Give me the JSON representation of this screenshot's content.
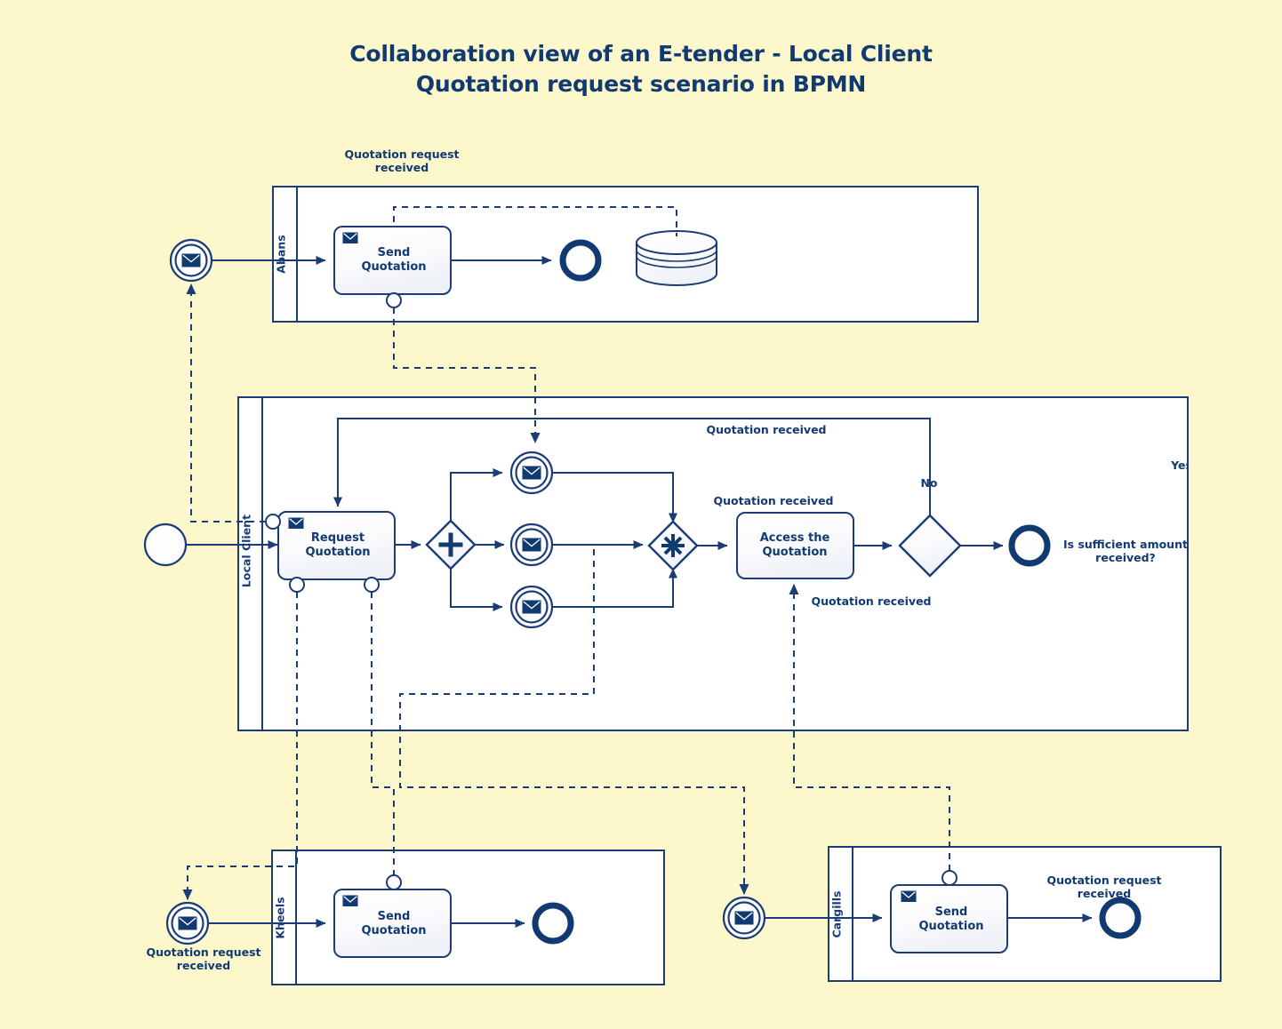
{
  "title": {
    "line1": "Collaboration view of an E-tender - Local Client",
    "line2": "Quotation request scenario in BPMN"
  },
  "colors": {
    "background": "#FCF8CC",
    "stroke": "#1C3C78",
    "text": "#113A72",
    "pool_fill": "#FFFFFF"
  },
  "pools": [
    {
      "id": "abans",
      "lane_label": "Abans",
      "tasks": [
        {
          "label_line1": "Send",
          "label_line2": "Quotation"
        }
      ],
      "events": [
        {
          "name": "message-start-event",
          "label": "Quotation request\nreceived",
          "label_line1": "Quotation request",
          "label_line2": "received"
        },
        {
          "name": "end-event",
          "label": ""
        }
      ],
      "artifacts": [
        {
          "name": "data-store",
          "label": ""
        }
      ]
    },
    {
      "id": "local-client",
      "lane_label": "Local Client",
      "tasks": [
        {
          "label_line1": "Request",
          "label_line2": "Quotation"
        },
        {
          "label_line1": "Access the",
          "label_line2": "Quotation"
        }
      ],
      "gateways": [
        {
          "name": "parallel-gateway",
          "symbol": "+"
        },
        {
          "name": "complex-gateway",
          "symbol": "*"
        },
        {
          "name": "exclusive-gateway",
          "symbol": ""
        }
      ],
      "flow_labels": {
        "top_quotation_received": "Quotation received",
        "mid_quotation_received": "Quotation received",
        "bottom_quotation_received": "Quotation received",
        "no": "No",
        "yes": "Yes",
        "decision_question_line1": "Is sufficient amount",
        "decision_question_line2": "received?"
      }
    },
    {
      "id": "kheels",
      "lane_label": "Kheels",
      "tasks": [
        {
          "label_line1": "Send",
          "label_line2": "Quotation"
        }
      ],
      "events": [
        {
          "name": "message-start-event",
          "label_line1": "Quotation request",
          "label_line2": "received"
        },
        {
          "name": "end-event",
          "label": ""
        }
      ]
    },
    {
      "id": "cargills",
      "lane_label": "Cargills",
      "tasks": [
        {
          "label_line1": "Send",
          "label_line2": "Quotation"
        }
      ],
      "events": [
        {
          "name": "message-start-event",
          "label": ""
        },
        {
          "name": "end-event",
          "label_line1": "Quotation request",
          "label_line2": "received"
        }
      ]
    }
  ],
  "labels": {
    "abans_lane": "Abans",
    "local_client_lane": "Local Client",
    "kheels_lane": "Kheels",
    "cargills_lane": "Cargills",
    "abans_start_l1": "Quotation request",
    "abans_start_l2": "received",
    "abans_task_l1": "Send",
    "abans_task_l2": "Quotation",
    "lc_task1_l1": "Request",
    "lc_task1_l2": "Quotation",
    "lc_task2_l1": "Access the",
    "lc_task2_l2": "Quotation",
    "qr_top": "Quotation received",
    "qr_mid": "Quotation received",
    "qr_bottom": "Quotation received",
    "no": "No",
    "yes": "Yes",
    "question_l1": "Is sufficient amount",
    "question_l2": "received?",
    "kheels_start_l1": "Quotation request",
    "kheels_start_l2": "received",
    "kheels_task_l1": "Send",
    "kheels_task_l2": "Quotation",
    "cargills_task_l1": "Send",
    "cargills_task_l2": "Quotation",
    "cargills_end_l1": "Quotation request",
    "cargills_end_l2": "received"
  }
}
